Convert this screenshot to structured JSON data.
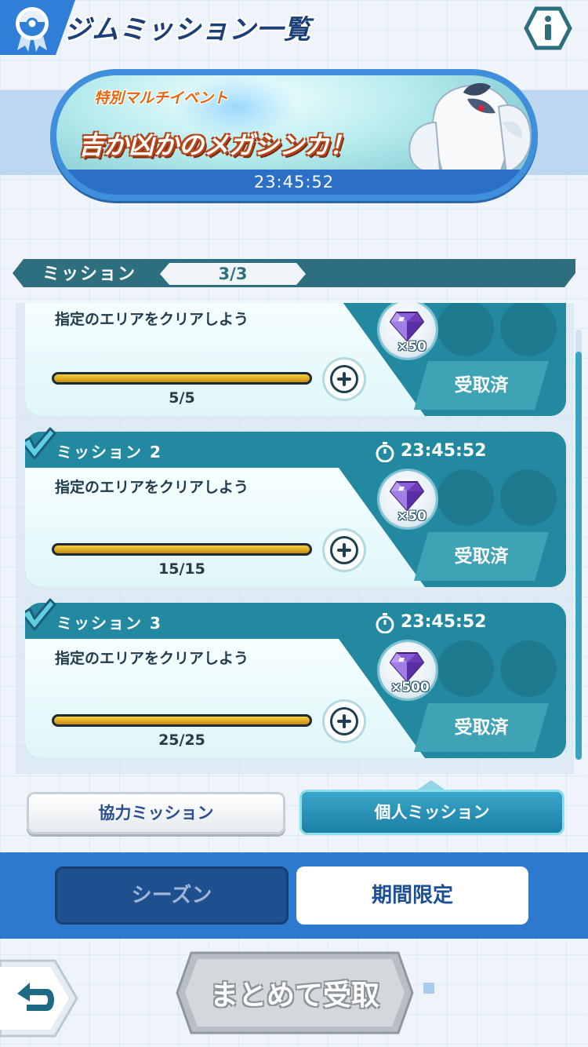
{
  "header": {
    "title": "ジムミッション一覧",
    "badge_icon": "pokeball-medal-icon",
    "info_icon": "info-icon"
  },
  "event_banner": {
    "subtitle": "特別マルチイベント",
    "title": "吉か凶かのメガシンカ！",
    "timer": "23:45:52"
  },
  "mission_bar": {
    "label": "ミッション",
    "count": "3/3"
  },
  "missions": [
    {
      "name": "",
      "description": "指定のエリアをクリアしよう",
      "progress": "5/5",
      "progress_fraction": 1.0,
      "reward_qty": "×50",
      "status": "受取済",
      "completed": true
    },
    {
      "name": "ミッション 2",
      "timer": "23:45:52",
      "description": "指定のエリアをクリアしよう",
      "progress": "15/15",
      "progress_fraction": 1.0,
      "reward_qty": "×50",
      "status": "受取済",
      "completed": true
    },
    {
      "name": "ミッション 3",
      "timer": "23:45:52",
      "description": "指定のエリアをクリアしよう",
      "progress": "25/25",
      "progress_fraction": 1.0,
      "reward_qty": "×500",
      "status": "受取済",
      "completed": true
    }
  ],
  "mission_tabs": {
    "coop": "協力ミッション",
    "personal": "個人ミッション",
    "selected": "personal"
  },
  "period_tabs": {
    "season": "シーズン",
    "limited": "期間限定",
    "selected": "limited"
  },
  "footer": {
    "back_icon": "back-arrow-icon",
    "receive_all": "まとめて受取"
  },
  "colors": {
    "accent_blue": "#2f7fd6",
    "mission_teal": "#2389a0",
    "progress_gold": "#e0a820"
  }
}
